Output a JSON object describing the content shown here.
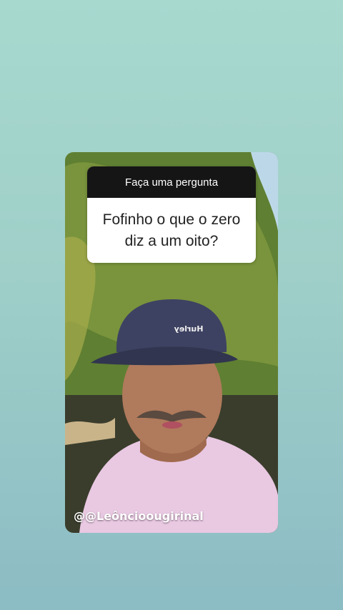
{
  "story": {
    "question_sticker": {
      "header": "Faça uma pergunta",
      "question": "Fofinho o que o zero diz a um oito?"
    },
    "handle": "@@Leôncioougirinal",
    "cap_logo": "Hurley"
  },
  "colors": {
    "background_top": "#a7d9cf",
    "background_bottom": "#8cbcc4",
    "sticker_header": "#151515",
    "sticker_body": "#ffffff"
  }
}
